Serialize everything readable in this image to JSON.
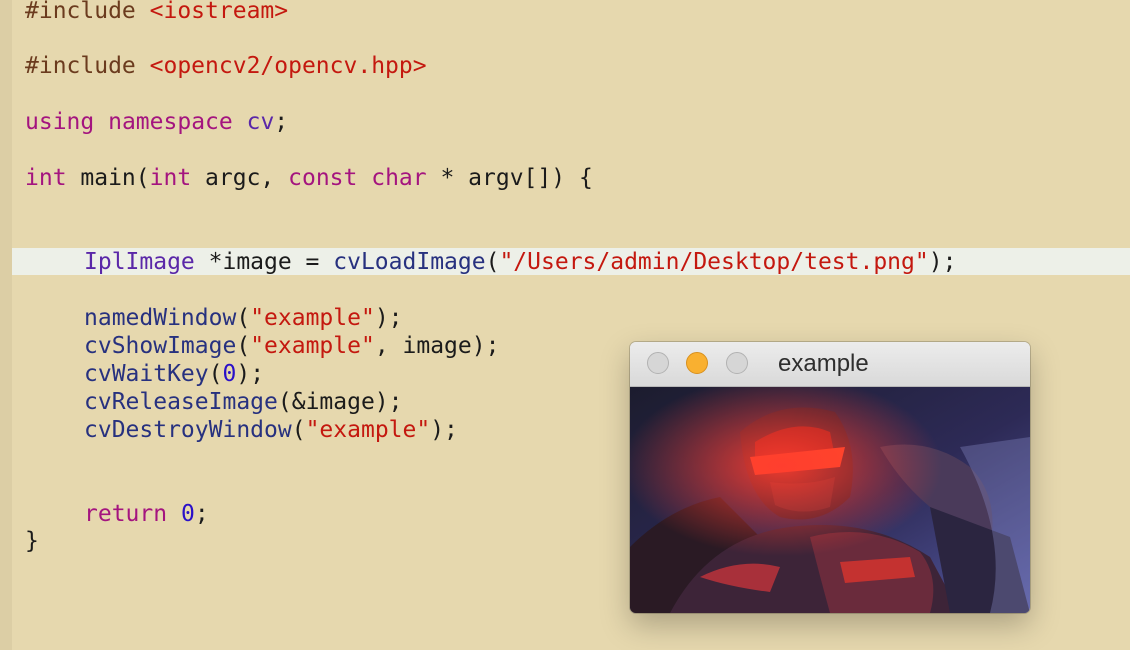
{
  "code": {
    "line1": {
      "pp": "#include",
      "space": " ",
      "header": "<iostream>"
    },
    "line2": {
      "pp": "#include",
      "space": " ",
      "header": "<opencv2/opencv.hpp>"
    },
    "line3": {
      "kw1": "using",
      "s1": " ",
      "kw2": "namespace",
      "s2": " ",
      "ns": "cv",
      "end": ";"
    },
    "line4": {
      "t1": "int",
      "s1": " main(",
      "t2": "int",
      "s2": " argc, ",
      "kw": "const",
      "s3": " ",
      "t3": "char",
      "s4": " * argv[]) {"
    },
    "line5": {
      "type": "IplImage",
      "s1": " *image = ",
      "fn": "cvLoadImage",
      "open": "(",
      "path": "\"/Users/admin/Desktop/test.png\"",
      "close": ");"
    },
    "line6": {
      "fn": "namedWindow",
      "open": "(",
      "arg": "\"example\"",
      "close": ");"
    },
    "line7": {
      "fn": "cvShowImage",
      "open": "(",
      "arg": "\"example\"",
      "close": ", image);"
    },
    "line8": {
      "fn": "cvWaitKey",
      "open": "(",
      "num": "0",
      "close": ");"
    },
    "line9": {
      "fn": "cvReleaseImage",
      "rest": "(&image);"
    },
    "line10": {
      "fn": "cvDestroyWindow",
      "open": "(",
      "arg": "\"example\"",
      "close": ");"
    },
    "line11": {
      "kw": "return",
      "s1": " ",
      "num": "0",
      "end": ";"
    },
    "line12": {
      "brace": "}"
    }
  },
  "window": {
    "title": "example",
    "image_icon": "game-character-image"
  },
  "colors": {
    "background": "#e6d8ae",
    "keyword": "#a4147f",
    "string": "#c4180f",
    "number": "#2a10c8",
    "highlight": "#edf0e8"
  }
}
